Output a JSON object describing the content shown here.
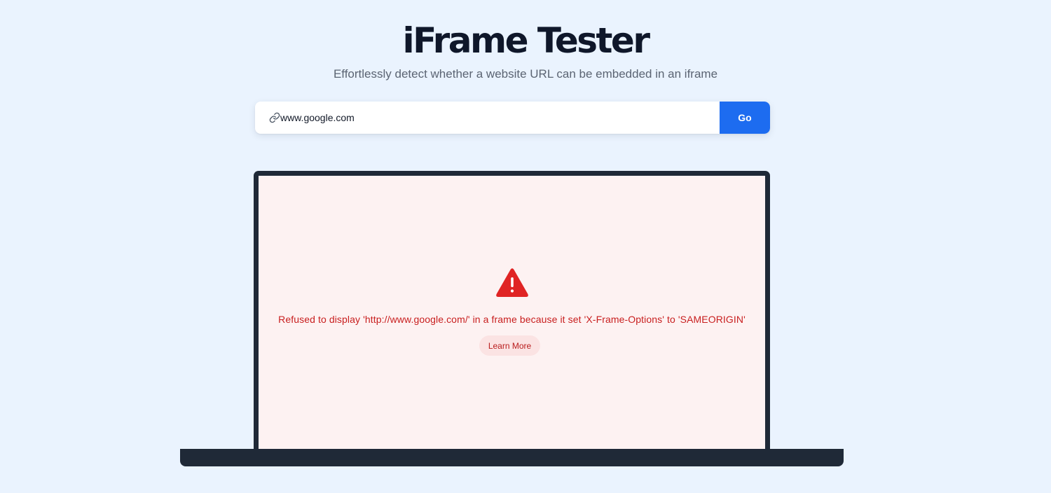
{
  "header": {
    "title": "iFrame Tester",
    "subtitle": "Effortlessly detect whether a website URL can be embedded in an iframe"
  },
  "url_bar": {
    "icon": "link-icon",
    "value": "www.google.com",
    "go_label": "Go"
  },
  "preview": {
    "status_icon": "warning-icon",
    "error_message": "Refused to display 'http://www.google.com/' in a frame because it set 'X-Frame-Options' to 'SAMEORIGIN'",
    "learn_more_label": "Learn More"
  },
  "colors": {
    "background": "#eaf3fe",
    "accent": "#1d6cf0",
    "error": "#c81e1e",
    "error_background": "#fdf2f2",
    "laptop_frame": "#1f2937"
  }
}
